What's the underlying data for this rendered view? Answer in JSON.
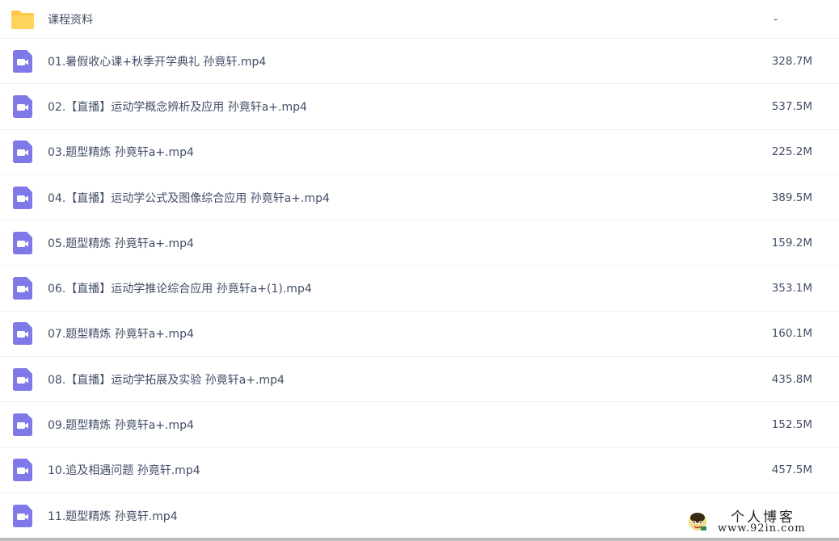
{
  "files": [
    {
      "type": "folder",
      "icon": "folder-icon",
      "name": "课程资料",
      "size": "-"
    },
    {
      "type": "video",
      "icon": "video-icon",
      "name": "01.暑假收心课+秋季开学典礼 孙竟轩.mp4",
      "size": "328.7M"
    },
    {
      "type": "video",
      "icon": "video-icon",
      "name": "02.【直播】运动学概念辨析及应用 孙竟轩a+.mp4",
      "size": "537.5M"
    },
    {
      "type": "video",
      "icon": "video-icon",
      "name": "03.题型精炼 孙竟轩a+.mp4",
      "size": "225.2M"
    },
    {
      "type": "video",
      "icon": "video-icon",
      "name": "04.【直播】运动学公式及图像综合应用 孙竟轩a+.mp4",
      "size": "389.5M"
    },
    {
      "type": "video",
      "icon": "video-icon",
      "name": "05.题型精炼 孙竟轩a+.mp4",
      "size": "159.2M"
    },
    {
      "type": "video",
      "icon": "video-icon",
      "name": "06.【直播】运动学推论综合应用 孙竟轩a+(1).mp4",
      "size": "353.1M"
    },
    {
      "type": "video",
      "icon": "video-icon",
      "name": "07.题型精炼 孙竟轩a+.mp4",
      "size": "160.1M"
    },
    {
      "type": "video",
      "icon": "video-icon",
      "name": "08.【直播】运动学拓展及实验 孙竟轩a+.mp4",
      "size": "435.8M"
    },
    {
      "type": "video",
      "icon": "video-icon",
      "name": "09.题型精炼 孙竟轩a+.mp4",
      "size": "152.5M"
    },
    {
      "type": "video",
      "icon": "video-icon",
      "name": "10.追及相遇问题 孙竟轩.mp4",
      "size": "457.5M"
    },
    {
      "type": "video",
      "icon": "video-icon",
      "name": "11.题型精炼 孙竟轩.mp4",
      "size": ""
    }
  ],
  "watermark": {
    "title": "个人博客",
    "url": "www.92in.com"
  },
  "colors": {
    "folder": "#fcc846",
    "video": "#7e78e8",
    "text": "#424e67",
    "divider": "#f1f2f5"
  }
}
